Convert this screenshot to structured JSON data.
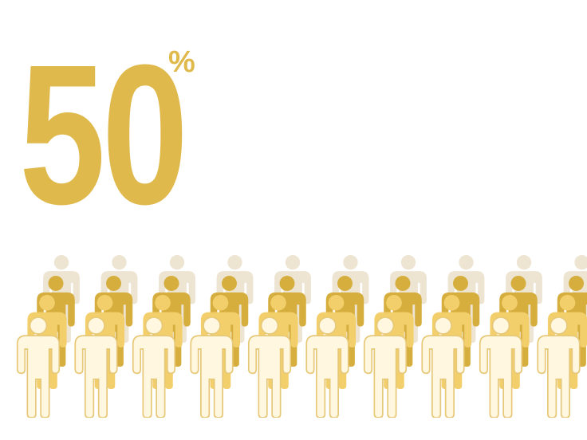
{
  "stat": {
    "number": "50",
    "unit": "%"
  },
  "colors": {
    "stat_text": "#E0B94C",
    "row_back": "#EDE4D2",
    "row_second": "#D6AE3E",
    "row_third": "#F3CF6C",
    "row_front": "#FFF7DF",
    "front_outline": "#E6C878"
  },
  "crowd": {
    "icon": "person-icon",
    "rows": [
      {
        "name": "back",
        "count": 10
      },
      {
        "name": "second",
        "count": 10
      },
      {
        "name": "third",
        "count": 10
      },
      {
        "name": "front",
        "count": 10
      }
    ]
  }
}
